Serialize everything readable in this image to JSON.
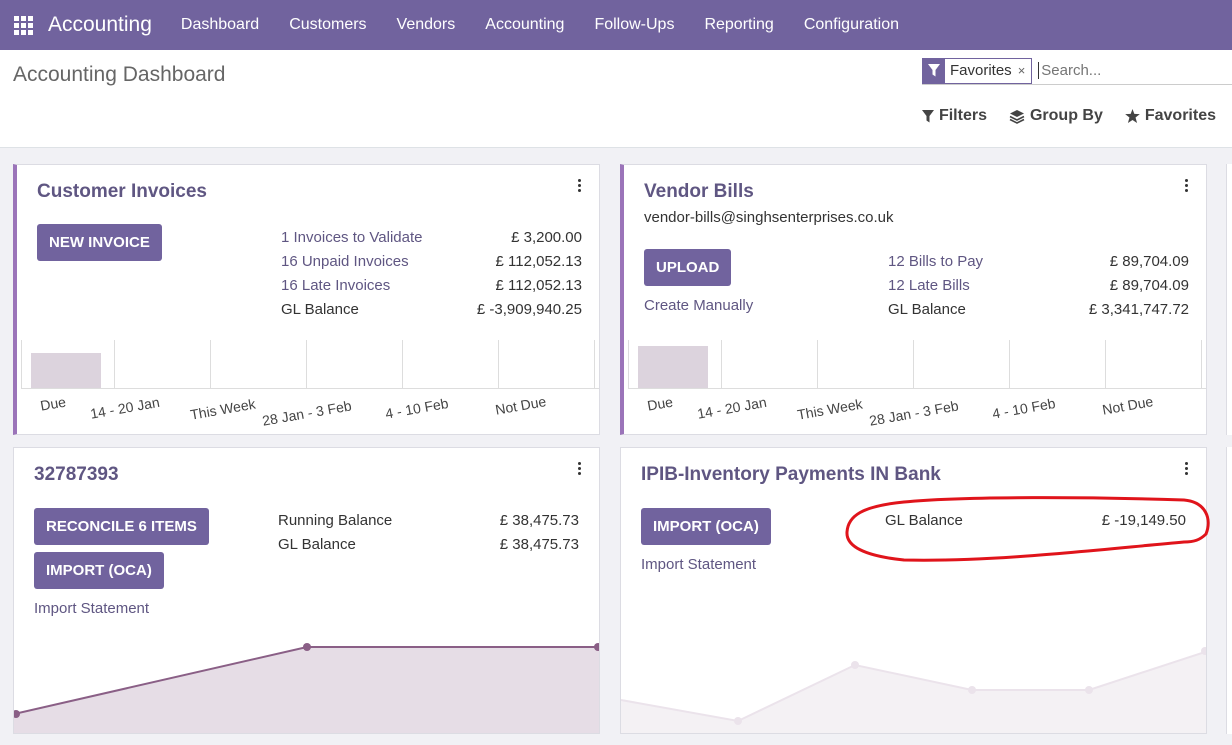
{
  "navbar": {
    "brand": "Accounting",
    "items": [
      "Dashboard",
      "Customers",
      "Vendors",
      "Accounting",
      "Follow-Ups",
      "Reporting",
      "Configuration"
    ]
  },
  "control": {
    "title": "Accounting Dashboard",
    "facet": "Favorites",
    "facet_close": "×",
    "search_placeholder": "Search...",
    "filters": "Filters",
    "groupby": "Group By",
    "favorites": "Favorites"
  },
  "customer_invoices": {
    "title": "Customer Invoices",
    "button": "NEW INVOICE",
    "stats": [
      {
        "label": "1 Invoices to Validate",
        "value": "£ 3,200.00"
      },
      {
        "label": "16 Unpaid Invoices",
        "value": "£ 112,052.13"
      },
      {
        "label": "16 Late Invoices",
        "value": "£ 112,052.13"
      },
      {
        "label": "GL Balance",
        "value": "£ -3,909,940.25"
      }
    ],
    "chart_labels": [
      "Due",
      "14 - 20 Jan",
      "This Week",
      "28 Jan - 3 Feb",
      "4 - 10 Feb",
      "Not Due"
    ]
  },
  "vendor_bills": {
    "title": "Vendor Bills",
    "email": "vendor-bills@singhsenterprises.co.uk",
    "button": "UPLOAD",
    "link": "Create Manually",
    "stats": [
      {
        "label": "12 Bills to Pay",
        "value": "£ 89,704.09"
      },
      {
        "label": "12 Late Bills",
        "value": "£ 89,704.09"
      },
      {
        "label": "GL Balance",
        "value": "£ 3,341,747.72"
      }
    ],
    "chart_labels": [
      "Due",
      "14 - 20 Jan",
      "This Week",
      "28 Jan - 3 Feb",
      "4 - 10 Feb",
      "Not Due"
    ]
  },
  "bank": {
    "title": "32787393",
    "button1": "RECONCILE 6 ITEMS",
    "button2": "IMPORT (OCA)",
    "link": "Import Statement",
    "stats": [
      {
        "label": "Running Balance",
        "value": "£ 38,475.73"
      },
      {
        "label": "GL Balance",
        "value": "£ 38,475.73"
      }
    ]
  },
  "ipib": {
    "title": "IPIB-Inventory Payments IN Bank",
    "button": "IMPORT (OCA)",
    "link": "Import Statement",
    "stats": [
      {
        "label": "GL Balance",
        "value": "£ -19,149.50"
      }
    ]
  },
  "colors": {
    "navbar": "#71639e",
    "button": "#71639e",
    "accent": "#9b74b9",
    "annotation": "#e0141b"
  }
}
